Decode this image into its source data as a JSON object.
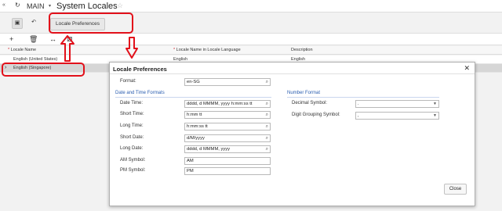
{
  "header": {
    "company": "MAIN",
    "title": "System Locales"
  },
  "toolbar": {
    "locale_preferences_label": "Locale Preferences"
  },
  "grid": {
    "columns": [
      "Locale Name",
      "Locale Name in Locale Language",
      "Description"
    ],
    "rows": [
      {
        "name": "English (United States)",
        "native": "English",
        "description": "English"
      },
      {
        "name": "English (Singapore)",
        "native": "",
        "description": ""
      }
    ]
  },
  "dialog": {
    "title": "Locale Preferences",
    "format_label": "Format:",
    "format_value": "en-SG",
    "date_section": "Date and Time Formats",
    "number_section": "Number Format",
    "fields": {
      "date_time_label": "Date Time:",
      "date_time_value": "dddd, d MMMM, yyyy h:mm:ss tt",
      "short_time_label": "Short Time:",
      "short_time_value": "h:mm tt",
      "long_time_label": "Long Time:",
      "long_time_value": "h:mm:ss tt",
      "short_date_label": "Short Date:",
      "short_date_value": "d/M/yyyy",
      "long_date_label": "Long Date:",
      "long_date_value": "dddd, d MMMM, yyyy",
      "am_label": "AM Symbol:",
      "am_value": "AM",
      "pm_label": "PM Symbol:",
      "pm_value": "PM",
      "decimal_label": "Decimal Symbol:",
      "decimal_value": ".",
      "grouping_label": "Digit Grouping Symbol:",
      "grouping_value": ","
    },
    "close_label": "Close"
  },
  "colors": {
    "annotation": "#e2101a",
    "section_title": "#2a5db0"
  }
}
